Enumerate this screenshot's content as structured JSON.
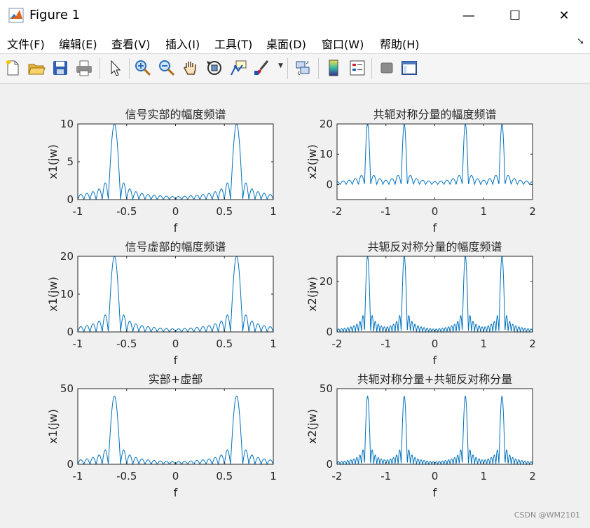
{
  "window": {
    "title": "Figure 1",
    "controls": [
      "—",
      "☐",
      "✕"
    ]
  },
  "menubar": {
    "items": [
      "文件(F)",
      "编辑(E)",
      "查看(V)",
      "插入(I)",
      "工具(T)",
      "桌面(D)",
      "窗口(W)",
      "帮助(H)"
    ],
    "corner_icon": "dock-arrow-icon"
  },
  "toolbar": {
    "buttons": [
      "new-figure-icon",
      "open-file-icon",
      "save-icon",
      "print-icon",
      "pointer-icon",
      "zoom-in-icon",
      "zoom-out-icon",
      "pan-hand-icon",
      "rotate-3d-icon",
      "data-cursor-icon",
      "brush-icon",
      "link-plot-icon",
      "colorbar-icon",
      "legend-icon",
      "hide-plot-tools-icon",
      "show-plot-tools-icon"
    ]
  },
  "colors": {
    "line": "#0072bd",
    "axes": "#262626",
    "background": "#f0f0f0"
  },
  "watermark": "CSDN @WM2101",
  "chart_data": [
    {
      "type": "line",
      "title": "信号实部的幅度频谱",
      "xlabel": "f",
      "ylabel": "x1(jw)",
      "xlim": [
        -1,
        1
      ],
      "ylim": [
        0,
        10
      ],
      "xticks": [
        "-1",
        "-0.5",
        "0",
        "0.5",
        "1"
      ],
      "yticks": [
        "0",
        "5",
        "10"
      ],
      "peaks": [
        -0.625,
        0.625
      ],
      "peak_value": 10,
      "main_lobe_halfwidth": 0.0625,
      "sidelobe_spacing": 0.0625,
      "sidelobe_first": 2.2
    },
    {
      "type": "line",
      "title": "共轭对称分量的幅度频谱",
      "xlabel": "f",
      "ylabel": "x2(jw)",
      "xlim": [
        -2,
        2
      ],
      "ylim": [
        -5,
        20
      ],
      "xticks": [
        "-2",
        "-1",
        "0",
        "1",
        "2"
      ],
      "yticks": [
        "0",
        "10",
        "20"
      ],
      "peaks": [
        -1.375,
        -0.625,
        0.625,
        1.375
      ],
      "peak_value": 20,
      "main_lobe_halfwidth": 0.0625,
      "sidelobe_spacing": 0.125,
      "sidelobe_first": 3
    },
    {
      "type": "line",
      "title": "信号虚部的幅度频谱",
      "xlabel": "f",
      "ylabel": "x1(jw)",
      "xlim": [
        -1,
        1
      ],
      "ylim": [
        0,
        20
      ],
      "xticks": [
        "-1",
        "-0.5",
        "0",
        "0.5",
        "1"
      ],
      "yticks": [
        "0",
        "10",
        "20"
      ],
      "peaks": [
        -0.625,
        0.625
      ],
      "peak_value": 20,
      "main_lobe_halfwidth": 0.0625,
      "sidelobe_spacing": 0.0625,
      "sidelobe_first": 4.5
    },
    {
      "type": "line",
      "title": "共轭反对称分量的幅度频谱",
      "xlabel": "f",
      "ylabel": "x2(jw)",
      "xlim": [
        -2,
        2
      ],
      "ylim": [
        0,
        30
      ],
      "xticks": [
        "-2",
        "-1",
        "0",
        "1",
        "2"
      ],
      "yticks": [
        "0",
        "20"
      ],
      "peaks": [
        -1.375,
        -0.625,
        0.625,
        1.375
      ],
      "peak_value": 30,
      "main_lobe_halfwidth": 0.0625,
      "sidelobe_spacing": 0.0625,
      "sidelobe_first": 6.5
    },
    {
      "type": "line",
      "title": "实部+虚部",
      "xlabel": "f",
      "ylabel": "x1(jw)",
      "xlim": [
        -1,
        1
      ],
      "ylim": [
        0,
        50
      ],
      "xticks": [
        "-1",
        "-0.5",
        "0",
        "0.5",
        "1"
      ],
      "yticks": [
        "0",
        "50"
      ],
      "peaks": [
        -0.625,
        0.625
      ],
      "peak_value": 45,
      "main_lobe_halfwidth": 0.0625,
      "sidelobe_spacing": 0.0625,
      "sidelobe_first": 9.5
    },
    {
      "type": "line",
      "title": "共轭对称分量+共轭反对称分量",
      "xlabel": "f",
      "ylabel": "x2(jw)",
      "xlim": [
        -2,
        2
      ],
      "ylim": [
        0,
        50
      ],
      "xticks": [
        "-2",
        "-1",
        "0",
        "1",
        "2"
      ],
      "yticks": [
        "0",
        "50"
      ],
      "peaks": [
        -1.375,
        -0.625,
        0.625,
        1.375
      ],
      "peak_value": 45,
      "main_lobe_halfwidth": 0.0625,
      "sidelobe_spacing": 0.0625,
      "sidelobe_first": 9.5
    }
  ]
}
